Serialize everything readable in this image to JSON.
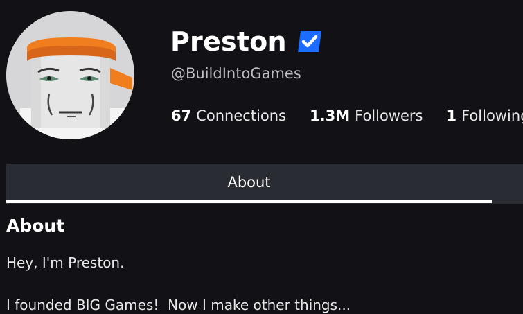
{
  "profile": {
    "display_name": "Preston",
    "username": "@BuildIntoGames",
    "verified": true,
    "avatar_icon": "roblox-avatar-headband",
    "badge_icon": "verified-check-icon",
    "accent_color": "#1c6cff",
    "headband_color": "#f07d1e"
  },
  "stats": [
    {
      "value": "67",
      "label": "Connections"
    },
    {
      "value": "1.3M",
      "label": "Followers"
    },
    {
      "value": "1",
      "label": "Following"
    }
  ],
  "tabs": [
    {
      "label": "About",
      "active": true
    }
  ],
  "about": {
    "heading": "About",
    "lines": [
      "Hey, I'm Preston.",
      "I founded BIG Games!  Now I make other things..."
    ]
  }
}
